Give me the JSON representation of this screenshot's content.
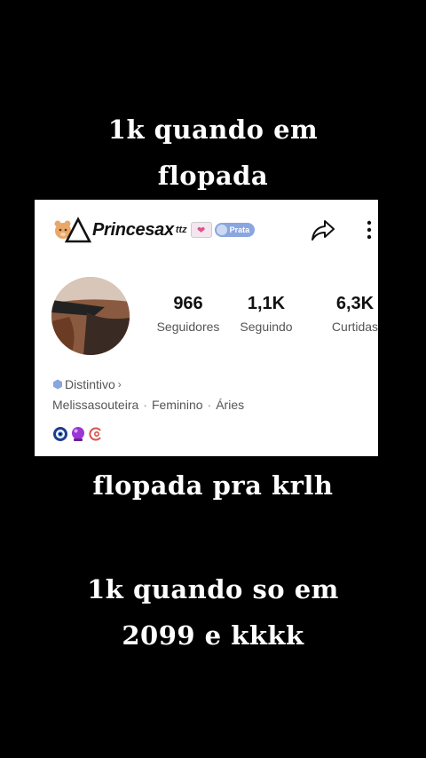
{
  "captions": {
    "top": [
      "1k quando em",
      "flopada"
    ],
    "middle": "flopada pra krlh",
    "bottom": [
      "1k quando so em",
      "2099 e kkkk"
    ]
  },
  "profile": {
    "username": "Princesax",
    "username_suffix": "ttz",
    "badge_label": "Prata",
    "stats": [
      {
        "value": "966",
        "label": "Seguidores"
      },
      {
        "value": "1,1K",
        "label": "Seguindo"
      },
      {
        "value": "6,3K",
        "label": "Curtidas"
      }
    ],
    "distintivo_label": "Distintivo",
    "distintivo_chevron": "›",
    "info": [
      "Melissasouteira",
      "Feminino",
      "Áries"
    ],
    "info_separator": "·",
    "icons": [
      "eye-badge-icon",
      "purple-orb-icon",
      "red-swirl-icon",
      "share-icon",
      "more-icon",
      "prata-badge-icon",
      "heart-badge-icon"
    ]
  },
  "colors": {
    "background": "#000000",
    "card": "#ffffff",
    "badge": "#8aa6e0",
    "heart": "#e0508a"
  }
}
